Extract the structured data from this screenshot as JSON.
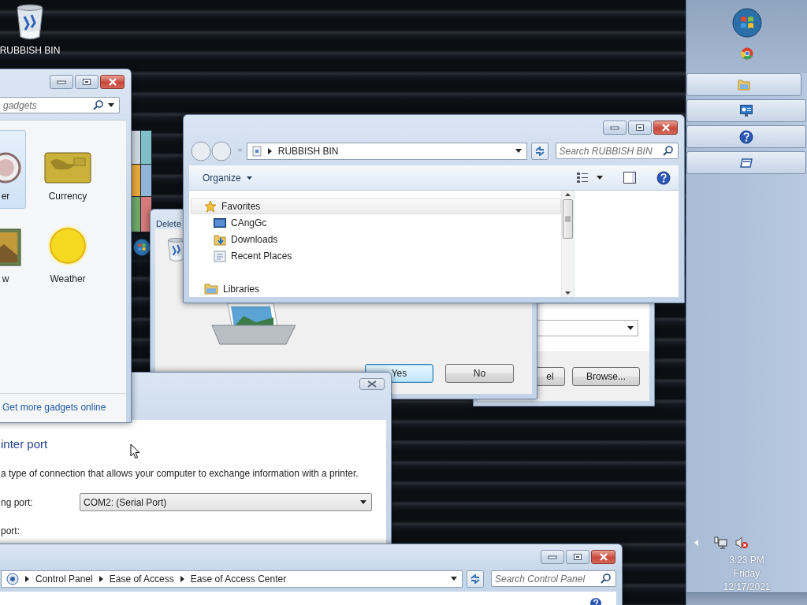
{
  "desktop_icons": [
    {
      "label": "RUBBISH BIN"
    }
  ],
  "browse_window": {
    "buttons": [
      "el",
      "Browse..."
    ]
  },
  "delete_dialog": {
    "title": "Delete",
    "buttons": [
      {
        "label": "Yes",
        "focused": true
      },
      {
        "label": "No",
        "focused": false
      }
    ]
  },
  "gadgets_window": {
    "search": {
      "placeholder": "gadgets"
    },
    "gadgets": [
      {
        "label": "er",
        "selected": true
      },
      {
        "label": "Currency",
        "selected": false
      },
      {
        "label": "w",
        "selected": false
      },
      {
        "label": "Weather",
        "selected": false
      }
    ],
    "footer_link": "Get more gadgets online"
  },
  "explorer": {
    "address": [
      "RUBBISH BIN"
    ],
    "search": {
      "placeholder": "Search RUBBISH BIN"
    },
    "toolbar": {
      "organize": "Organize"
    },
    "nav": [
      {
        "label": "Favorites",
        "selected": true,
        "children": [
          {
            "label": "CAngGc",
            "selected": false
          },
          {
            "label": "Downloads",
            "selected": false
          },
          {
            "label": "Recent Places",
            "selected": false
          }
        ]
      },
      {
        "label": "Libraries",
        "selected": false
      }
    ]
  },
  "printer_dialog": {
    "heading": "inter port",
    "description": "a type of connection that allows your computer to exchange information with a printer.",
    "fields": [
      {
        "label": "ng port:",
        "value": "COM2: (Serial Port)"
      },
      {
        "label": "port:"
      }
    ]
  },
  "control_panel": {
    "breadcrumb": [
      "Control Panel",
      "Ease of Access",
      "Ease of Access Center"
    ],
    "search": {
      "placeholder": "Search Control Panel"
    }
  },
  "taskbar": {
    "clock": {
      "time": "3:23 PM",
      "day": "Friday",
      "date": "12/17/2021"
    }
  }
}
